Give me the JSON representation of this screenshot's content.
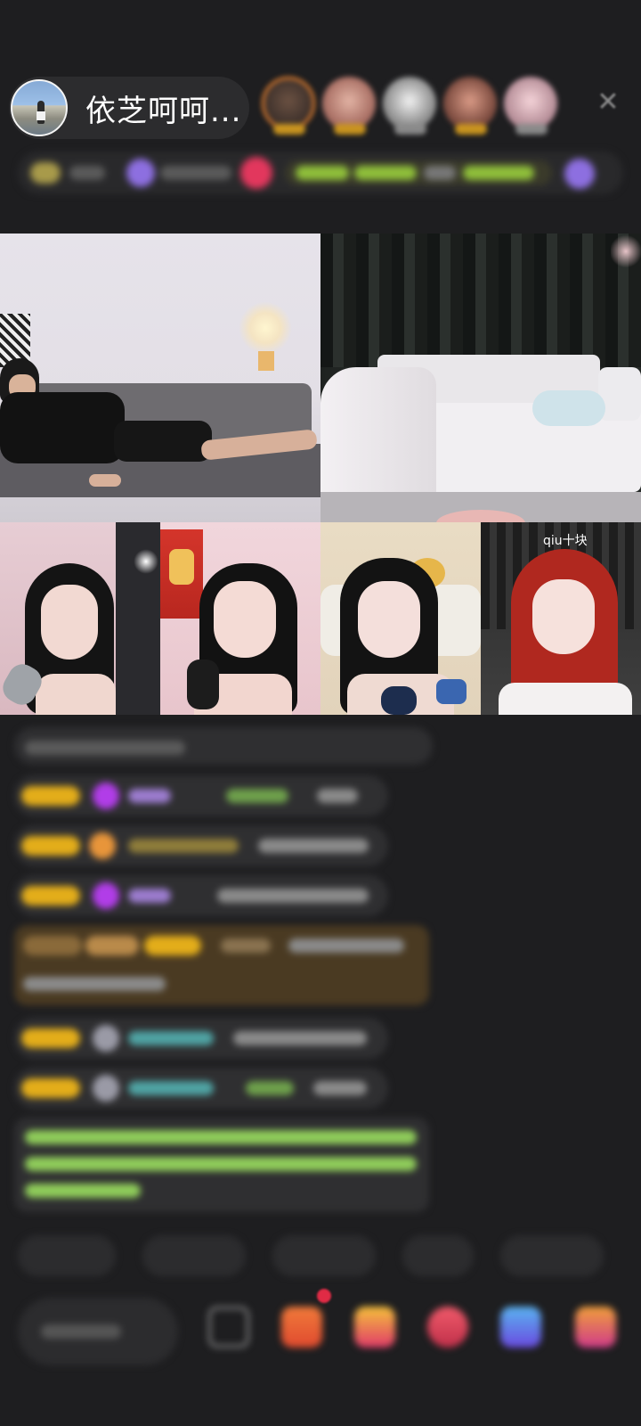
{
  "header": {
    "host_name": "依芝呵呵...",
    "close_icon": "close-icon",
    "viewer_avatars": [
      {
        "ring": "#e8812e",
        "tag": "#c9941f"
      },
      {
        "ring": "transparent",
        "tag": "#c9941f"
      },
      {
        "ring": "transparent",
        "tag": "#8a8a8a"
      },
      {
        "ring": "transparent",
        "tag": "#c9941f"
      },
      {
        "ring": "transparent",
        "tag": "#8a8a8a"
      }
    ]
  },
  "video_grid": {
    "tiles": [
      {
        "name": "video-tile-1",
        "label": ""
      },
      {
        "name": "video-tile-2",
        "label": ""
      },
      {
        "name": "video-tile-3",
        "label": ""
      },
      {
        "name": "video-tile-4",
        "label": ""
      },
      {
        "name": "video-tile-5",
        "label": ""
      },
      {
        "name": "video-tile-6",
        "label": "qiu十块"
      }
    ]
  },
  "colors": {
    "background": "#1e1e20",
    "badge_gold": "#e3ad1a",
    "gem_purple": "#b13de8",
    "name_purple": "#9c7ccf",
    "name_green": "#6ea04b",
    "name_teal": "#4fa3a3",
    "system_green": "#8fcc5a",
    "highlight_brown": "#4a3a22"
  }
}
